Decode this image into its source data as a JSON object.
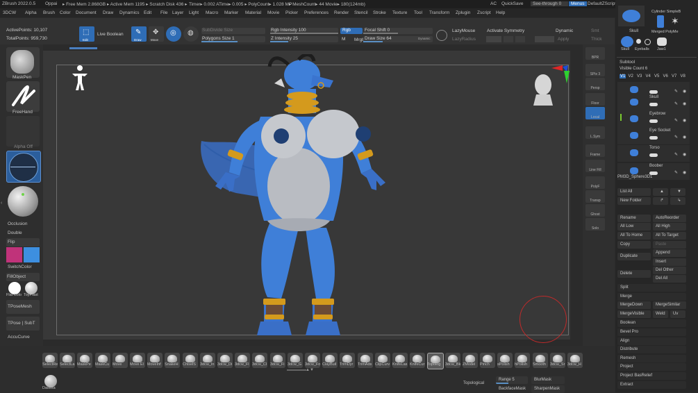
{
  "titlebar": {
    "app": "ZBrush 2022.0.5",
    "user": "Oppai",
    "stats": "▸ Free Mem 2.868GB ▸ Active Mem 1195 ▸ Scratch Disk 436 ▸",
    "timers": "Timer▸ 0.002 ATime▸ 0.005 ▸ PolyCount▸ 1.028 MP",
    "mesh": "▸ MeshCount▸ 44  Movie▸ 180(124mb)",
    "ac": "AC",
    "quicksave": "QuickSave",
    "seethrough": "See-through",
    "seethrough_val": "0",
    "menus_btn": "Menus",
    "zscript": "DefaultZScript"
  },
  "menubar": [
    "3DCW",
    "Alpha",
    "Brush",
    "Color",
    "Document",
    "Draw",
    "Dynamics",
    "Edit",
    "File",
    "Layer",
    "Light",
    "Macro",
    "Marker",
    "Material",
    "Movie",
    "Picker",
    "Preferences",
    "Render",
    "Stencil",
    "Stroke",
    "Texture",
    "Tool",
    "Transform",
    "Zplugin",
    "Zscript",
    "Help"
  ],
  "toolbar": {
    "active_points": "ActivePoints: 10,107",
    "total_points": "TotalPoints: 959,730",
    "live_boolean": "Live Boolean",
    "edit": "Edit",
    "draw": "Draw",
    "move": "Move",
    "subdiv": "SubDivide Size",
    "polygons": "Polygons Size 1",
    "rgb_intensity": "Rgb Intensity 100",
    "rgb": "Rgb",
    "z_intensity": "Z Intensity 25",
    "m": "M",
    "mrgb": "Mrgb",
    "focal_shift": "Focal Shift 0",
    "draw_size": "Draw Size 64",
    "dynamic_tag": "Dynamic",
    "lazymouse": "LazyMouse",
    "lazyradius": "LazyRadius",
    "activate_symmetry": "Activate Symmetry",
    "dynamic": "Dynamic",
    "apply": "Apply",
    "smt": "Smt",
    "thick": "Thick"
  },
  "left": {
    "maskpen": "MaskPen",
    "freehand": "FreeHand",
    "alpha_off": "Alpha Off",
    "occlusion": "Occlusion",
    "double": "Double",
    "flip": "Flip",
    "switchcolor": "SwitchColor",
    "fillobject": "FillObject",
    "flatcolor": "Flat Colo",
    "toyplastic": "ToyPlast",
    "tposemesh": "TPoseMesh",
    "tpose_subt": "TPose | SubT",
    "accucurve": "AccuCurve",
    "main_color": "#c0337a",
    "secondary_color": "#3d8fe0"
  },
  "rcol": [
    "BPR",
    "SPix 3",
    "Persp",
    "Floor",
    "Local",
    "L.Sym",
    "Frame",
    "Line Fill",
    "PolyF",
    "Transp",
    "Ghost",
    "Solo"
  ],
  "brushes": [
    "SelectRe",
    "SelectLa",
    "MaskPe",
    "MaskCu",
    "Move",
    "Move El",
    "MoveInf",
    "SnakeH",
    "ChiselS",
    "3dcw_In",
    "3dcw_Di",
    "3dcw_Fl",
    "3dcw_Cl",
    "3dcw_Fi",
    "3dcw_G",
    "3dcw_Fo",
    "ClayBuil",
    "TrimDyr",
    "TrimAds",
    "ClipCurv",
    "KnifeLas",
    "KnifeCur",
    "Topolog",
    "3dcw_Bk",
    "ZModel",
    "Pinch",
    "sPolish",
    "hPolish",
    "Smooth",
    "3dcw_Sr",
    "3dcw_H"
  ],
  "bottom": {
    "material": "Dasiota",
    "topological": "Topological",
    "range": "Range 5",
    "blurmask": "BlurMask",
    "backfacemask": "BackfaceMask",
    "sharpenmask": "SharpenMask"
  },
  "rpanel": {
    "tool_top": [
      "Cylinder SimpleB",
      "Merged PolyMe"
    ],
    "tool_names": [
      "Skull",
      "Eyeballs",
      "Jaw1"
    ],
    "subtool": "Subtool",
    "visible_count": "Visible Count 6",
    "versions": [
      "V1",
      "V2",
      "V3",
      "V4",
      "V5",
      "V6",
      "V7",
      "V8"
    ],
    "subtools": [
      "",
      "Skull",
      "Eyebrow",
      "Eye Socket",
      "Torso",
      "Boober"
    ],
    "pm3d": "PM3D_Sphere3D1",
    "list_all": "List All",
    "new_folder": "New Folder",
    "rename": "Rename",
    "autoreorder": "AutoReorder",
    "all_low": "All Low",
    "all_high": "All High",
    "all_to_home": "All To Home",
    "all_to_target": "All To Target",
    "copy": "Copy",
    "paste": "Paste",
    "append": "Append",
    "duplicate": "Duplicate",
    "insert": "Insert",
    "del_other": "Del Other",
    "delete": "Delete",
    "del_all": "Del All",
    "split": "Split",
    "merge": "Merge",
    "mergedown": "MergeDown",
    "mergesimilar": "MergeSimilar",
    "mergevisible": "MergeVisible",
    "weld": "Weld",
    "uv": "Uv",
    "boolean": "Boolean",
    "bevel_pro": "Bevel Pro",
    "align": "Align",
    "distribute": "Distribute",
    "remesh": "Remesh",
    "project": "Project",
    "project_basrelief": "Project BasRelief",
    "extract": "Extract"
  }
}
